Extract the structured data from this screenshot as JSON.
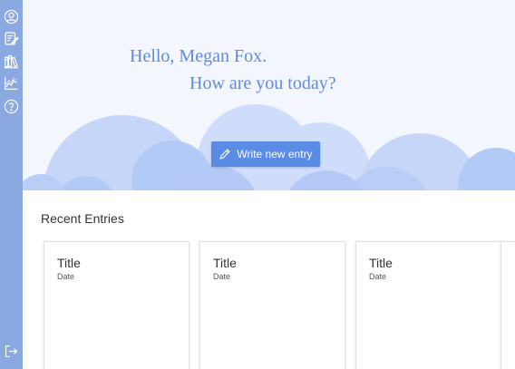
{
  "sidebar": {
    "items": [
      {
        "icon": "profile-icon"
      },
      {
        "icon": "journal-icon"
      },
      {
        "icon": "library-icon"
      },
      {
        "icon": "chart-icon"
      },
      {
        "icon": "help-icon"
      }
    ],
    "logout_icon": "logout-icon"
  },
  "hero": {
    "greeting_line1": "Hello, Megan Fox.",
    "greeting_line2": "How are you today?",
    "write_button_label": "Write new entry"
  },
  "recent": {
    "heading": "Recent Entries",
    "entries": [
      {
        "title": "Title",
        "date": "Date"
      },
      {
        "title": "Title",
        "date": "Date"
      },
      {
        "title": "Title",
        "date": "Date"
      }
    ]
  },
  "colors": {
    "sidebar": "#8aa9e0",
    "accent": "#5a8ce6",
    "greeting_text": "#5f8ae2",
    "hero_background": "#f3f6fd"
  }
}
